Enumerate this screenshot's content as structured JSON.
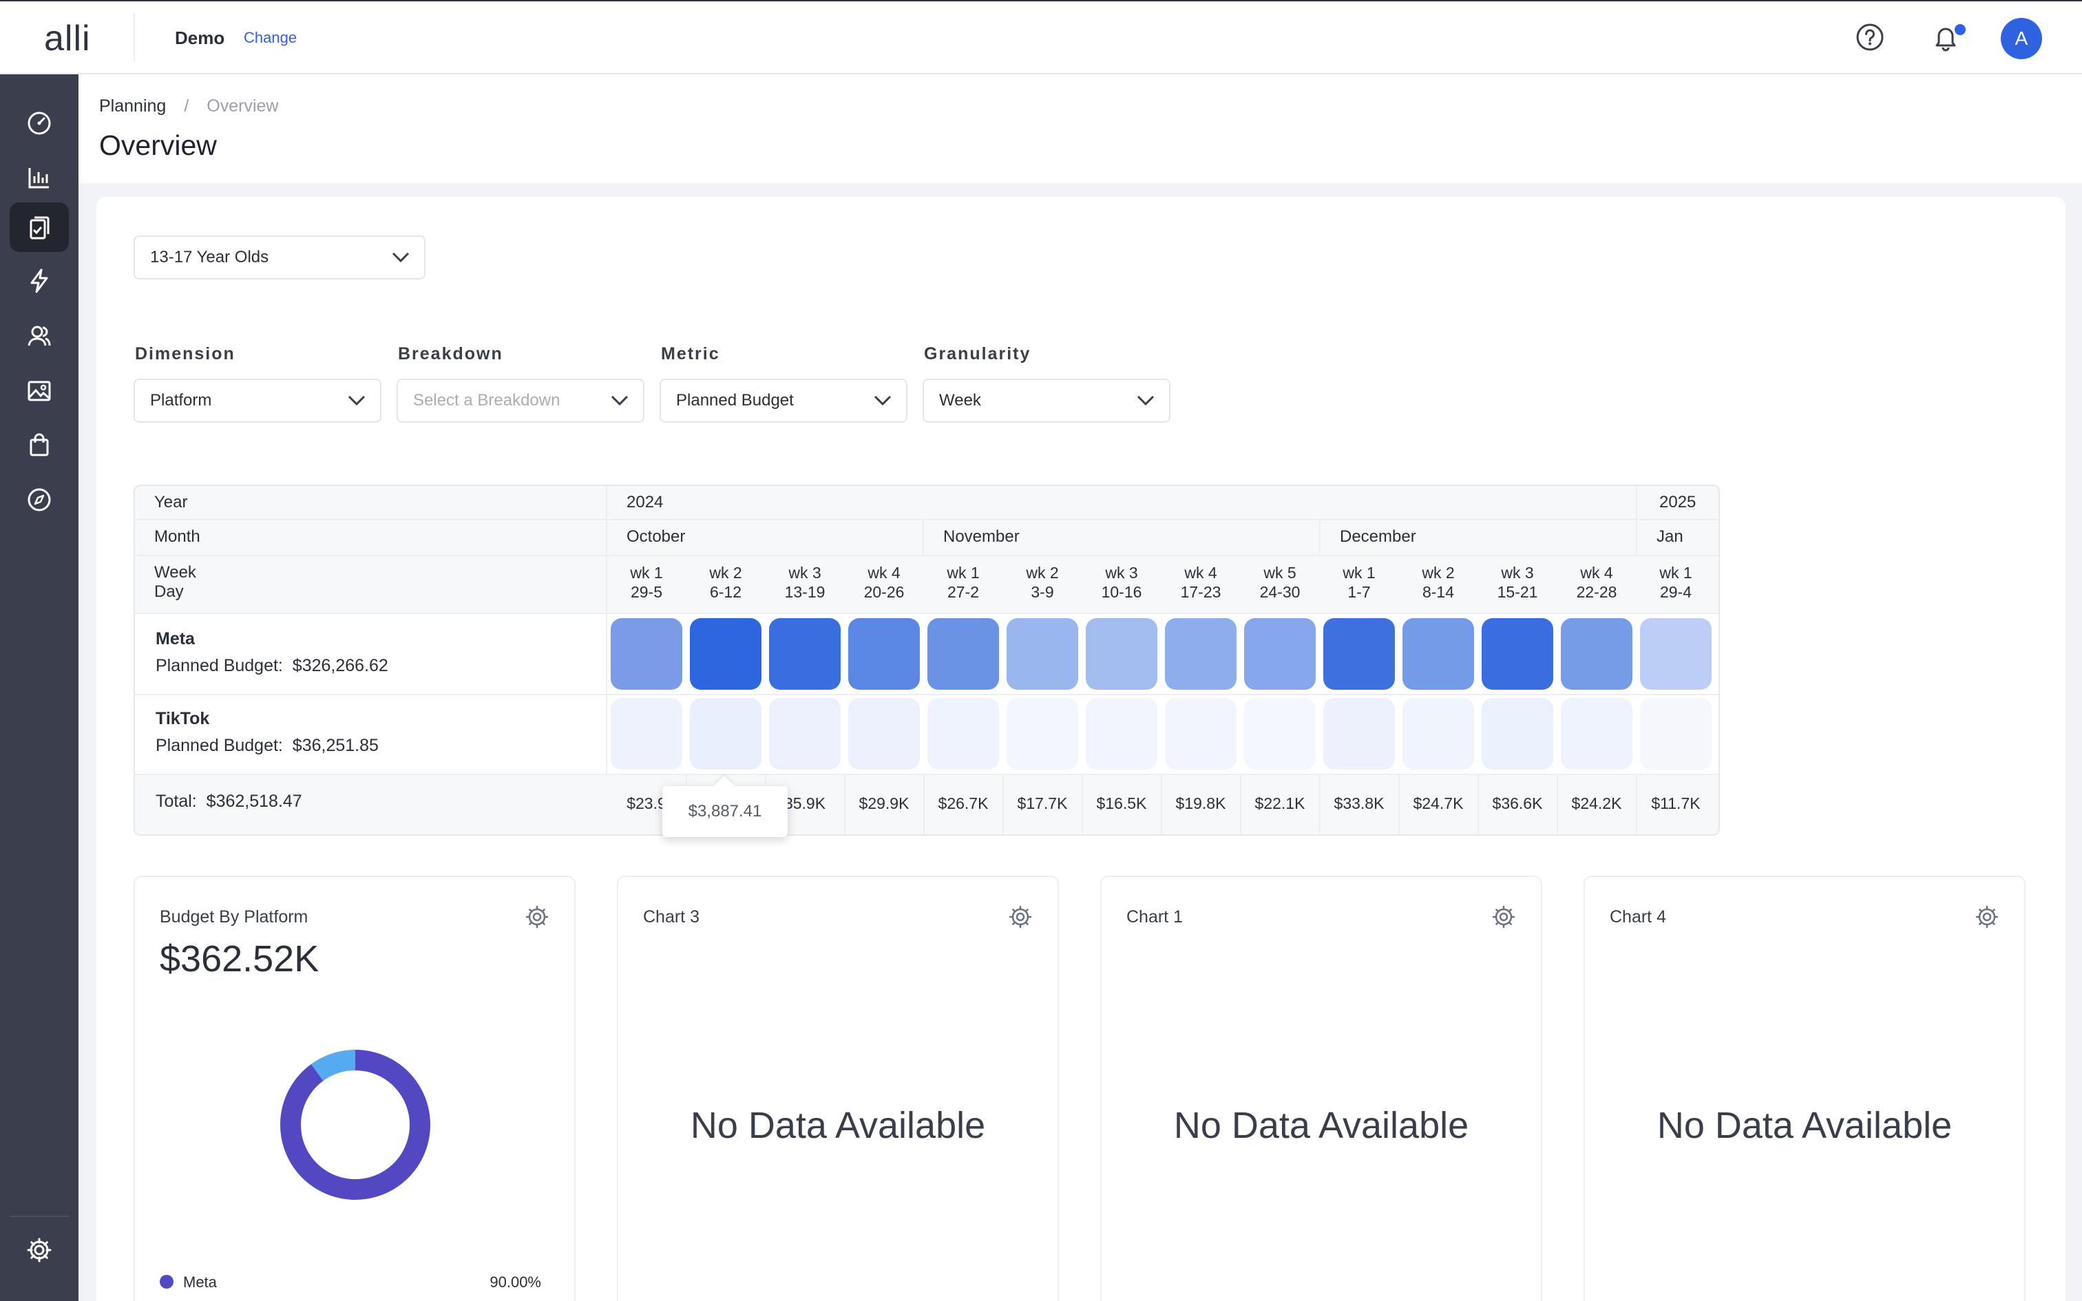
{
  "app": {
    "logo": "alli",
    "account": "Demo",
    "change": "Change",
    "avatar_initial": "A"
  },
  "breadcrumb": {
    "parent": "Planning",
    "separator": "/",
    "current": "Overview"
  },
  "page_title": "Overview",
  "audience_select": "13-17 Year Olds",
  "filters": {
    "dimension": {
      "label": "Dimension",
      "value": "Platform"
    },
    "breakdown": {
      "label": "Breakdown",
      "placeholder": "Select a Breakdown"
    },
    "metric": {
      "label": "Metric",
      "value": "Planned Budget"
    },
    "granularity": {
      "label": "Granularity",
      "value": "Week"
    }
  },
  "grid": {
    "year_label": "Year",
    "month_label": "Month",
    "week_label": "Week",
    "day_label": "Day",
    "years": [
      "2024",
      "2025"
    ],
    "months": [
      "October",
      "November",
      "December",
      "Jan"
    ],
    "weeks": [
      {
        "wk": "wk 1",
        "days": "29-5"
      },
      {
        "wk": "wk 2",
        "days": "6-12"
      },
      {
        "wk": "wk 3",
        "days": "13-19"
      },
      {
        "wk": "wk 4",
        "days": "20-26"
      },
      {
        "wk": "wk 1",
        "days": "27-2"
      },
      {
        "wk": "wk 2",
        "days": "3-9"
      },
      {
        "wk": "wk 3",
        "days": "10-16"
      },
      {
        "wk": "wk 4",
        "days": "17-23"
      },
      {
        "wk": "wk 5",
        "days": "24-30"
      },
      {
        "wk": "wk 1",
        "days": "1-7"
      },
      {
        "wk": "wk 2",
        "days": "8-14"
      },
      {
        "wk": "wk 3",
        "days": "15-21"
      },
      {
        "wk": "wk 4",
        "days": "22-28"
      },
      {
        "wk": "wk 1",
        "days": "29-4"
      }
    ],
    "rows": [
      {
        "name": "Meta",
        "metric_label": "Planned Budget:",
        "metric_value": "$326,266.62",
        "colors": [
          "#7a9ce8",
          "#2d66de",
          "#3a6ee0",
          "#5b87e4",
          "#6a93e6",
          "#9ab6ee",
          "#a3bcef",
          "#8eaded",
          "#86a7ec",
          "#3f70e0",
          "#749be8",
          "#3a6de0",
          "#769ce8",
          "#bccef5"
        ]
      },
      {
        "name": "TikTok",
        "metric_label": "Planned Budget:",
        "metric_value": "$36,251.85",
        "colors": [
          "#edf2fc",
          "#e9effc",
          "#ebf0fc",
          "#ebf0fc",
          "#eff3fd",
          "#f3f6fd",
          "#f2f5fd",
          "#f2f5fd",
          "#f4f7fd",
          "#ecf1fc",
          "#f0f4fd",
          "#eaf0fc",
          "#eff3fd",
          "#f5f7fd"
        ]
      }
    ],
    "total_label": "Total:",
    "total_value": "$362,518.47",
    "totals": [
      "$23.9",
      "",
      "35.9K",
      "$29.9K",
      "$26.7K",
      "$17.7K",
      "$16.5K",
      "$19.8K",
      "$22.1K",
      "$33.8K",
      "$24.7K",
      "$36.6K",
      "$24.2K",
      "$11.7K"
    ],
    "tooltip": "$3,887.41"
  },
  "charts": [
    {
      "title": "Budget By Platform",
      "value": "$362.52K",
      "legend": [
        {
          "name": "Meta",
          "pct": "90.00%",
          "color": "#5249c2"
        }
      ],
      "chart_data": {
        "type": "pie",
        "slices": [
          {
            "name": "Meta",
            "value": 90.0,
            "color": "#5249c2"
          },
          {
            "name": "TikTok",
            "value": 10.0,
            "color": "#55aaf0"
          }
        ]
      }
    },
    {
      "title": "Chart 3",
      "empty": "No Data Available"
    },
    {
      "title": "Chart 1",
      "empty": "No Data Available"
    },
    {
      "title": "Chart 4",
      "empty": "No Data Available"
    }
  ]
}
